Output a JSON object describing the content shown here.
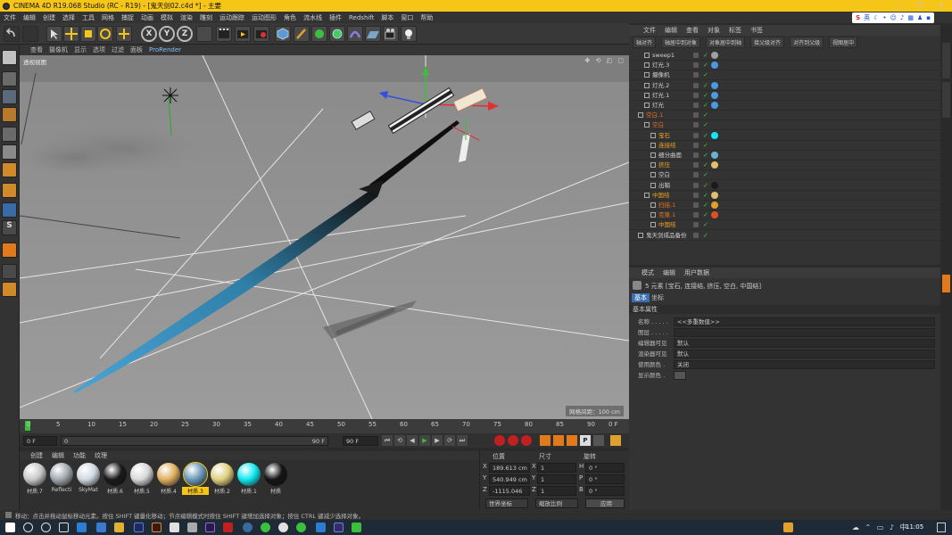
{
  "window": {
    "title": "CINEMA 4D R19.068 Studio (RC - R19) - [鬼天剑02.c4d *] - 主要",
    "controls": [
      "—",
      "❐",
      "✕"
    ]
  },
  "menu": [
    "文件",
    "编辑",
    "创建",
    "选择",
    "工具",
    "网格",
    "捕捉",
    "动画",
    "模拟",
    "渲染",
    "雕刻",
    "运动跟踪",
    "运动图形",
    "角色",
    "流水线",
    "插件",
    "Redshift",
    "脚本",
    "窗口",
    "帮助"
  ],
  "ime": {
    "mode": "英"
  },
  "toolbar": {
    "axis": [
      "X",
      "Y",
      "Z"
    ]
  },
  "viewport": {
    "menu": [
      "查看",
      "摄像机",
      "显示",
      "选项",
      "过滤",
      "面板"
    ],
    "menu_extra": "ProRender",
    "label": "透视视图",
    "grid_spacing": "网格间距：100 cm"
  },
  "timeline": {
    "ticks": [
      "0",
      "5",
      "10",
      "15",
      "20",
      "25",
      "30",
      "35",
      "40",
      "45",
      "50",
      "55",
      "60",
      "65",
      "70",
      "75",
      "80",
      "85",
      "90"
    ],
    "end_label": "0 F",
    "start_field": "0 F",
    "current_field": "0 F",
    "range_end": "90 F",
    "end_field": "90 F",
    "slider_start": "0",
    "slider_end": "90 F"
  },
  "materials": {
    "menu": [
      "创建",
      "编辑",
      "功能",
      "纹理"
    ],
    "items": [
      {
        "label": "材质.7",
        "color": "#c8c8c8"
      },
      {
        "label": "Reflecti",
        "color": "#a0a8b0"
      },
      {
        "label": "SkyMat",
        "color": "#d0d8e0"
      },
      {
        "label": "材质.6",
        "color": "#1a1a1a"
      },
      {
        "label": "材质.5",
        "color": "#d8d8d8"
      },
      {
        "label": "材质.4",
        "color": "#e0b060"
      },
      {
        "label": "材质.3",
        "color": "#6a98b8"
      },
      {
        "label": "材质.2",
        "color": "#e0d080"
      },
      {
        "label": "材质.1",
        "color": "#10e8f0"
      },
      {
        "label": "材质",
        "color": "#141414"
      }
    ]
  },
  "coords": {
    "headers": [
      "位置",
      "尺寸",
      "旋转"
    ],
    "rows": [
      {
        "axis": "X",
        "pos": "189.613 cm",
        "size": "1",
        "rot_axis": "H",
        "rot": "0 °"
      },
      {
        "axis": "Y",
        "pos": "540.949 cm",
        "size": "1",
        "rot_axis": "P",
        "rot": "0 °"
      },
      {
        "axis": "Z",
        "pos": "-1115.046 cm",
        "size": "1",
        "rot_axis": "B",
        "rot": "0 °"
      }
    ],
    "mode": "世界坐标",
    "scale_mode": "缩放比例",
    "apply": "应用"
  },
  "object_manager": {
    "menu": [
      "文件",
      "编辑",
      "查看",
      "对象",
      "标签",
      "书签"
    ],
    "tools": [
      "轴对齐",
      "轴居中到对象",
      "对象居中到轴",
      "接父级对齐",
      "对齐到父级",
      "视图居中"
    ],
    "objects": [
      {
        "name": "sweep1",
        "indent": 1,
        "color": "#d0d0d0"
      },
      {
        "name": "灯光.3",
        "indent": 1,
        "color": "#d0d0d0"
      },
      {
        "name": "摄像机",
        "indent": 1,
        "color": "#d0d0d0"
      },
      {
        "name": "灯光.2",
        "indent": 1,
        "color": "#d0d0d0"
      },
      {
        "name": "灯光.1",
        "indent": 1,
        "color": "#d0d0d0"
      },
      {
        "name": "灯光",
        "indent": 1,
        "color": "#d0d0d0"
      },
      {
        "name": "空白.1",
        "indent": 0,
        "color": "#e07020"
      },
      {
        "name": "空白",
        "indent": 1,
        "color": "#e07020"
      },
      {
        "name": "宝石",
        "indent": 2,
        "color": "#f0a020"
      },
      {
        "name": "连接结",
        "indent": 2,
        "color": "#f0a020"
      },
      {
        "name": "细分曲面",
        "indent": 2,
        "color": "#d0d0d0"
      },
      {
        "name": "挤压",
        "indent": 2,
        "color": "#f0a020"
      },
      {
        "name": "空白",
        "indent": 2,
        "color": "#d0d0d0"
      },
      {
        "name": "出鞘",
        "indent": 2,
        "color": "#d0d0d0"
      },
      {
        "name": "中国结",
        "indent": 1,
        "color": "#f0a020"
      },
      {
        "name": "扫描.1",
        "indent": 2,
        "color": "#e07020"
      },
      {
        "name": "克隆.1",
        "indent": 2,
        "color": "#e07020"
      },
      {
        "name": "中国结",
        "indent": 2,
        "color": "#f0a020"
      },
      {
        "name": "鬼天剑成品备份",
        "indent": 0,
        "color": "#d0d0d0"
      }
    ]
  },
  "attributes": {
    "menu": [
      "模式",
      "编辑",
      "用户数据"
    ],
    "summary": "5 元素 [宝石, 连接结, 挤压, 空白, 中国结]",
    "tabs": [
      "基本",
      "坐标"
    ],
    "section": "基本属性",
    "fields": [
      {
        "label": "名称 . . . . .",
        "value": "<<多重数值>>"
      },
      {
        "label": "图层 . . . . .",
        "value": ""
      },
      {
        "label": "编辑器可见",
        "value": "默认"
      },
      {
        "label": "渲染器可见",
        "value": "默认"
      },
      {
        "label": "使用颜色 .",
        "value": "关闭"
      },
      {
        "label": "显示颜色 .",
        "value": ""
      }
    ]
  },
  "status": {
    "text": "移动：点击并拖动鼠标移动元素。按住 SHIFT 键量化移动；节点编辑模式时按住 SHIFT 键增加选择对象；按住 CTRL 键减少选择对象。"
  },
  "taskbar": {
    "time": "11:05"
  }
}
